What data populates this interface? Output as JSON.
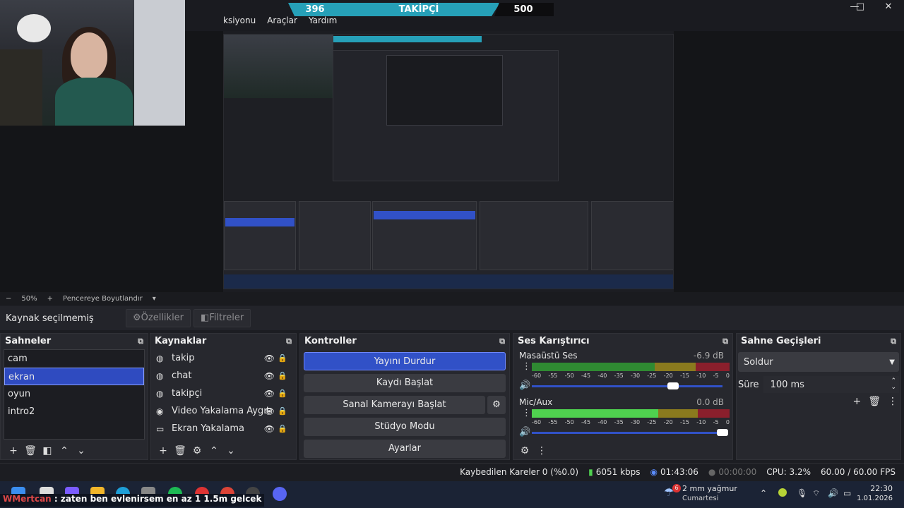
{
  "menu": {
    "items": [
      "ksiyonu",
      "Araçlar",
      "Yardım"
    ]
  },
  "follow_goal": {
    "current": "396",
    "label": "TAKİPÇİ",
    "goal": "500"
  },
  "window_controls": {
    "minimize": "—",
    "maximize": "□",
    "close": "✕"
  },
  "zoom": {
    "minus": "−",
    "value": "50%",
    "plus": "+",
    "fit": "Pencereye Boyutlandır",
    "dropdown": "▾"
  },
  "source_bar": {
    "no_selection": "Kaynak seçilmemiş",
    "properties": "Özellikler",
    "filters": "Filtreler"
  },
  "scenes": {
    "title": "Sahneler",
    "items": [
      "cam",
      "ekran",
      "oyun",
      "intro2"
    ],
    "selected": "ekran"
  },
  "sources": {
    "title": "Kaynaklar",
    "items": [
      {
        "name": "takip",
        "icon": "browser-icon"
      },
      {
        "name": "chat",
        "icon": "browser-icon"
      },
      {
        "name": "takipçi",
        "icon": "browser-icon"
      },
      {
        "name": "Video Yakalama Aygıtı",
        "icon": "camera-icon"
      },
      {
        "name": "Ekran Yakalama",
        "icon": "monitor-icon"
      }
    ]
  },
  "controls": {
    "title": "Kontroller",
    "stop_stream": "Yayını Durdur",
    "start_record": "Kaydı Başlat",
    "virtual_cam": "Sanal Kamerayı Başlat",
    "studio_mode": "Stüdyo Modu",
    "settings": "Ayarlar"
  },
  "mixer": {
    "title": "Ses Karıştırıcı",
    "channels": [
      {
        "name": "Masaüstü Ses",
        "db": "-6.9 dB",
        "level": 0.87
      },
      {
        "name": "Mic/Aux",
        "db": "0.0 dB",
        "level": 0.72
      }
    ],
    "ticks": [
      "-60",
      "-55",
      "-50",
      "-45",
      "-40",
      "-35",
      "-30",
      "-25",
      "-20",
      "-15",
      "-10",
      "-5",
      "0"
    ]
  },
  "transitions": {
    "title": "Sahne Geçişleri",
    "type": "Soldur",
    "duration_label": "Süre",
    "duration": "100 ms"
  },
  "status": {
    "dropped": "Kaybedilen Kareler 0 (%0.0)",
    "bitrate": "6051 kbps",
    "stream_time": "01:43:06",
    "rec_time": "00:00:00",
    "cpu": "CPU: 3.2%",
    "fps": "60.00 / 60.00 FPS"
  },
  "chat_overlay": {
    "user": "WMertcan",
    "message": " : zaten ben evlenirsem en az 1 1.5m gelcek"
  },
  "taskbar": {
    "weather": "2 mm yağmur",
    "weather_sub": "Cumartesi",
    "weather_badge": "6",
    "time": "22:30",
    "date": "1.01.2026"
  },
  "colors": {
    "accent": "#3151c7",
    "teal": "#26a0b8",
    "meter_green": "#4fd14f",
    "meter_yellow": "#c8c42a",
    "meter_red": "#c0303a"
  }
}
